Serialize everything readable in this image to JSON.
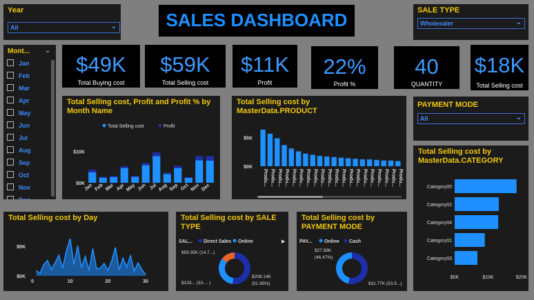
{
  "dashboard_title": "SALES DASHBOARD",
  "year_slicer": {
    "label": "Year",
    "value": "All"
  },
  "sale_type_slicer": {
    "label": "SALE TYPE",
    "value": "Wholesaler"
  },
  "payment_mode_slicer": {
    "label": "PAYMENT MODE",
    "value": "All"
  },
  "month_slicer": {
    "label": "Mont...",
    "items": [
      "Jan",
      "Feb",
      "Mar",
      "Apr",
      "May",
      "Jun",
      "Jul",
      "Aug",
      "Sep",
      "Oct",
      "Nov",
      "Dec"
    ]
  },
  "kpis": [
    {
      "value": "$49K",
      "label": "Total Buying cost"
    },
    {
      "value": "$59K",
      "label": "Total Selling cost"
    },
    {
      "value": "$11K",
      "label": "Profit"
    },
    {
      "value": "22%",
      "label": "Profit %"
    },
    {
      "value": "40",
      "label": "QUANTITY"
    },
    {
      "value": "$18K",
      "label": "Total Selling cost"
    }
  ],
  "colors": {
    "accent": "#1e90ff",
    "dark_blue": "#1c2fa8",
    "orange": "#e8632b",
    "title_yellow": "#f2c811",
    "panel": "#1b1b1b"
  },
  "chart_data": [
    {
      "id": "month",
      "type": "bar",
      "title": "Total Selling cost, Profit and Profit % by Month Name",
      "legend": [
        "Total Selling cost",
        "Profit"
      ],
      "legend_position": "top",
      "categories": [
        "Jan",
        "Feb",
        "Mar",
        "Apr",
        "May",
        "Jun",
        "Jul",
        "Aug",
        "Sep",
        "Oct",
        "Nov",
        "Dec"
      ],
      "series": [
        {
          "name": "Total Selling cost",
          "values": [
            3.3,
            1.6,
            1.8,
            4.7,
            1.9,
            5.6,
            8.5,
            2.8,
            4.7,
            1.6,
            7.2,
            7.1
          ]
        },
        {
          "name": "Profit",
          "values": [
            0.9,
            0.3,
            0.4,
            0.6,
            0.3,
            0.7,
            1.2,
            0.4,
            0.7,
            0.2,
            1.3,
            1.4
          ]
        }
      ],
      "yticks": [
        "$10K",
        "$0K"
      ],
      "ylim": [
        0,
        11
      ]
    },
    {
      "id": "product",
      "type": "bar",
      "title": "Total Selling cost by MasterData.PRODUCT",
      "category_label": "Produ...",
      "values": [
        6.4,
        5.7,
        4.9,
        3.7,
        3.1,
        2.6,
        2.2,
        2.0,
        1.8,
        1.7,
        1.6,
        1.5,
        1.4,
        1.3,
        1.2,
        1.2,
        1.1,
        1.0,
        1.0,
        0.9
      ],
      "yticks": [
        "$5K",
        "$0K"
      ],
      "ylim": [
        0,
        7
      ]
    },
    {
      "id": "category",
      "type": "bar",
      "orientation": "horizontal",
      "title": "Total Selling cost by MasterData.CATEGORY",
      "categories": [
        "Category05",
        "Category02",
        "Category04",
        "Category01",
        "Category03"
      ],
      "values": [
        18.5,
        13.2,
        13.0,
        9.0,
        6.8
      ],
      "xticks": [
        "$0K",
        "$10K",
        "$20K"
      ],
      "xlim": [
        0,
        20
      ]
    },
    {
      "id": "day",
      "type": "area",
      "title": "Total Selling cost by Day",
      "x": [
        1,
        2,
        3,
        4,
        5,
        6,
        7,
        8,
        9,
        10,
        11,
        12,
        13,
        14,
        15,
        16,
        17,
        18,
        19,
        20,
        21,
        22,
        23,
        24,
        25,
        26,
        27,
        28,
        29,
        30
      ],
      "values": [
        0.9,
        0.4,
        1.9,
        2.6,
        1.1,
        2.2,
        3.5,
        1.3,
        4.2,
        6.3,
        1.9,
        5.1,
        1.4,
        3.3,
        0.9,
        4.6,
        1.2,
        1.3,
        2.1,
        0.9,
        2.5,
        4.8,
        1.0,
        3.0,
        1.5,
        3.4,
        0.8,
        2.2,
        1.1,
        0.2
      ],
      "xticks": [
        0,
        10,
        20,
        30
      ],
      "yticks": [
        "$5K",
        "$0K"
      ],
      "ylim": [
        0,
        7
      ]
    },
    {
      "id": "sale_type",
      "type": "pie",
      "donut": true,
      "title": "Total Selling cost by SALE TYPE",
      "legend_title": "SAL...",
      "legend": [
        "Direct Sales",
        "Online"
      ],
      "slices": [
        {
          "name": "Direct Sales",
          "value": 208.14,
          "percent": 51.85,
          "color": "#1c2fa8"
        },
        {
          "name": "Online",
          "value": 133.0,
          "percent": 33.0,
          "color": "#1e90ff"
        },
        {
          "name": "Other",
          "value": 59.35,
          "percent": 14.7,
          "color": "#e8632b"
        }
      ],
      "labels": [
        "$59.35K (14.7...)",
        "$208.14K",
        "(51.85%)",
        "$133... (33.... )"
      ]
    },
    {
      "id": "payment_mode",
      "type": "pie",
      "donut": true,
      "title": "Total Selling cost by PAYMENT MODE",
      "legend_title": "PAY...",
      "legend": [
        "Online",
        "Cash"
      ],
      "slices": [
        {
          "name": "Online",
          "value": 27.58,
          "percent": 46.47,
          "color": "#1e90ff"
        },
        {
          "name": "Cash",
          "value": 31.77,
          "percent": 53.5,
          "color": "#1c2fa8"
        }
      ],
      "labels": [
        "$27.58K",
        "(46.47%)",
        "$31.77K (53.5...)"
      ]
    }
  ]
}
